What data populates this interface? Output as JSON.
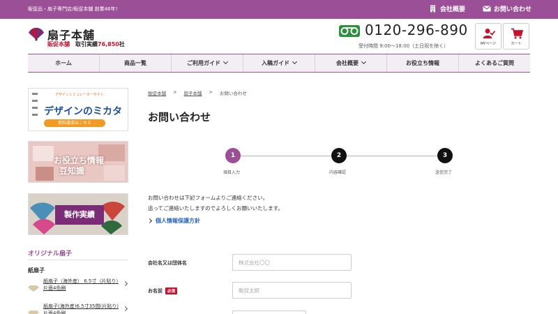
{
  "topbar": {
    "tagline": "販促品・扇子専門店/販促本舗 創業46年！",
    "company_link": "会社概要",
    "contact_link": "お問い合わせ"
  },
  "header": {
    "logo_name": "扇子本舗",
    "logo_sub_brand": "販促本舗",
    "logo_record_label": "取引実績",
    "logo_record_count": "76,850",
    "logo_record_unit": "社",
    "phone": "0120-296-890",
    "hours": "受付時間 9:00〜18:00（土日祝を除く）",
    "mypage_label": "MYページ",
    "cart_label": "カート"
  },
  "nav": {
    "items": [
      {
        "label": "ホーム",
        "dropdown": false
      },
      {
        "label": "商品一覧",
        "dropdown": false
      },
      {
        "label": "ご利用ガイド",
        "dropdown": true
      },
      {
        "label": "入稿ガイド",
        "dropdown": true
      },
      {
        "label": "会社概要",
        "dropdown": true
      },
      {
        "label": "お役立ち情報",
        "dropdown": false
      },
      {
        "label": "よくあるご質問",
        "dropdown": false
      }
    ]
  },
  "sidebar": {
    "banner1_small": "デザインシミュレーターサイト",
    "banner1_big": "デザインのミカタ",
    "banner1_cta": "資料請求はこちら",
    "banner2_line1": "お役立ち情報",
    "banner2_line2": "豆知識",
    "banner3_label": "製作実績",
    "section_title": "オリジナル扇子",
    "subsection_title": "紙扇子",
    "products": [
      {
        "name": "紙扇子（海外産） 6.5寸（片貼り）片面4色刷"
      },
      {
        "name": "紙扇子(海外産)6.5寸35間(片貼り)片面4色刷"
      }
    ]
  },
  "breadcrumb": [
    "販促本舗",
    "扇子本舗",
    "お問い合わせ"
  ],
  "page_title": "お問い合わせ",
  "steps": [
    {
      "num": "1",
      "label": "項目入力",
      "active": true
    },
    {
      "num": "2",
      "label": "内容確認",
      "active": false
    },
    {
      "num": "3",
      "label": "送信完了",
      "active": false
    }
  ],
  "intro": {
    "line1": "お問い合わせは下記フォームよりご連絡ください。",
    "line2": "追ってご連絡いたしますのでよろしくお願いいたします。"
  },
  "privacy_link": "個人情報保護方針",
  "form": {
    "company_label": "会社名又は団体名",
    "company_placeholder": "株式会社〇〇",
    "name_label": "お名前",
    "required_badge": "必須",
    "name_placeholder": "販促太郎"
  },
  "colors": {
    "brand_purple": "#9b4f96",
    "required_red": "#c4122f",
    "link_blue": "#2a66b8",
    "freedial_green": "#2e8f3e"
  }
}
